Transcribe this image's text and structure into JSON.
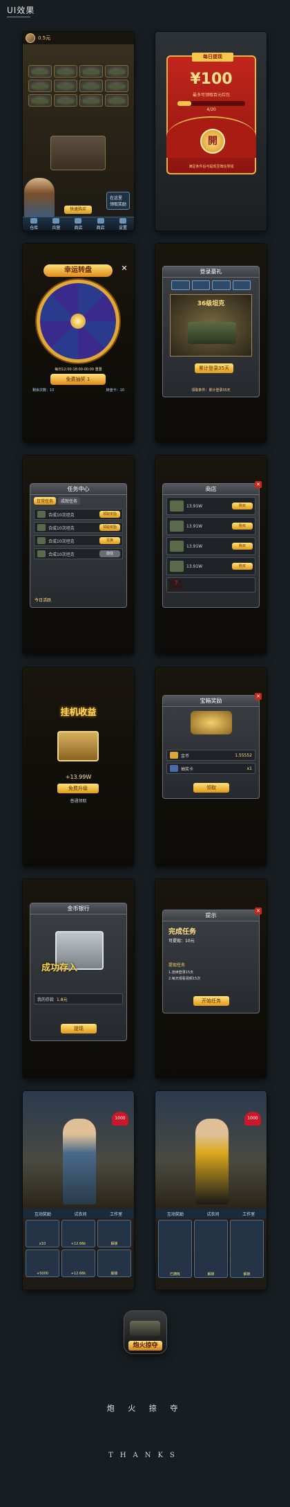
{
  "header": {
    "title": "UI效果"
  },
  "nav": [
    "仓库",
    "兵营",
    "商店",
    "商店",
    "设置"
  ],
  "screen1": {
    "gold": "0.5元",
    "speech": "在这里\n领取奖励",
    "buy_button": "快速购买"
  },
  "screen2": {
    "tag": "每日提现",
    "amount": "¥100",
    "sub": "最多可领取百元红包",
    "progress_label": "4/20",
    "progress": 0.2,
    "open": "開",
    "footer": "满足条件后可提现至微信零钱"
  },
  "screen3": {
    "title": "幸运转盘",
    "time": "每日12:00-18:00-00:00 重置",
    "button": "免费抽奖 1",
    "left_stat": "剩余次数：10",
    "right_stat": "转盘卡：10"
  },
  "screen4": {
    "title": "登录豪礼",
    "tank_name": "36级坦克",
    "button": "累计登录35天",
    "note": "领取条件：累计登录35天"
  },
  "screen5": {
    "title": "任务中心",
    "tabs": [
      "日常任务",
      "成就任务"
    ],
    "rows": [
      {
        "text": "合成10次坦克",
        "action": "领取奖励"
      },
      {
        "text": "合成10次坦克",
        "action": "领取奖励"
      },
      {
        "text": "合成10次坦克",
        "action": "兑换"
      },
      {
        "text": "合成10次坦克",
        "action": "前往"
      }
    ],
    "footer": "今日活跃"
  },
  "screen6": {
    "title": "商店",
    "rows": [
      {
        "text": "13.91W",
        "action": "购买"
      },
      {
        "text": "13.91W",
        "action": "购买"
      },
      {
        "text": "13.91W",
        "action": "购买"
      },
      {
        "text": "13.91W",
        "action": "购买"
      }
    ],
    "locked": "?"
  },
  "screen7": {
    "title": "挂机收益",
    "amount": "+13.99W",
    "button": "免费升级",
    "link": "普通领取"
  },
  "screen8": {
    "title": "宝箱奖励",
    "rows": [
      {
        "text": "金币",
        "value": "1.55552"
      },
      {
        "text": "抽奖卡",
        "value": "x1"
      }
    ],
    "button": "领取"
  },
  "screen9": {
    "title": "金币银行",
    "stamp": "成功存入",
    "deposit_label": "我的存款",
    "deposit_value": "1.8元",
    "button": "提现"
  },
  "screen10": {
    "title": "提示",
    "headline": "完成任务",
    "sub": "可提现：10元",
    "task_title": "提现任务",
    "tasks": [
      "1.连续登录15天",
      "2.每天观看视频15次"
    ],
    "button": "开始任务"
  },
  "screen11": {
    "heart": "1000",
    "tabs": [
      "互动奖励",
      "试衣间",
      "工作室"
    ],
    "cells": [
      "x10",
      "+12.66k",
      "解锁",
      "+5000",
      "+12.66k",
      "解锁"
    ],
    "colors": {
      "char": "#4a6a8a"
    }
  },
  "screen12": {
    "heart": "1000",
    "tabs": [
      "互动奖励",
      "试衣间",
      "工作室"
    ],
    "cells": [
      "已拥有",
      "解锁",
      "解锁"
    ],
    "colors": {
      "char": "#d9a81c"
    }
  },
  "footer": {
    "logo_text": "炮火掠夺",
    "game_name": "炮 火 掠 夺",
    "thanks": "THANKS"
  }
}
